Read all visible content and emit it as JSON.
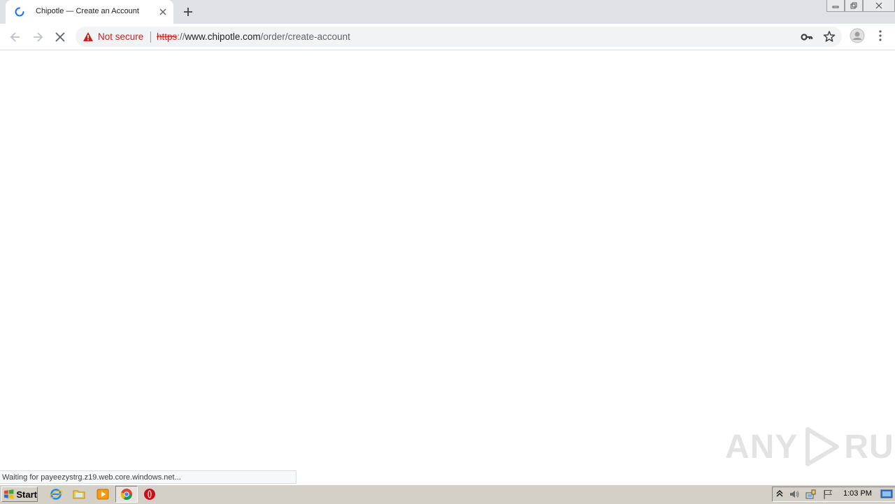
{
  "browser": {
    "tab": {
      "title": "Chipotle — Create an Account",
      "loading": true
    },
    "new_tab_icon": "plus-icon",
    "window_controls": [
      "minimize-icon",
      "restore-icon",
      "close-icon"
    ],
    "security_label": "Not secure",
    "url": {
      "scheme": "https",
      "separator": "://",
      "host": "www.chipotle.com",
      "path": "/order/create-account"
    },
    "status_text": "Waiting for payeezystrg.z19.web.core.windows.net..."
  },
  "watermark": {
    "text_left": "ANY",
    "text_right": "RUN"
  },
  "taskbar": {
    "start_label": "Start",
    "clock": "1:03 PM",
    "pinned": [
      "internet-explorer-icon",
      "folder-icon",
      "media-player-icon",
      "chrome-icon",
      "opera-icon"
    ]
  },
  "colors": {
    "danger": "#c5221f",
    "tabstrip": "#dee1e6",
    "omnibox": "#f1f3f4",
    "taskbar": "#d4d0c8"
  }
}
